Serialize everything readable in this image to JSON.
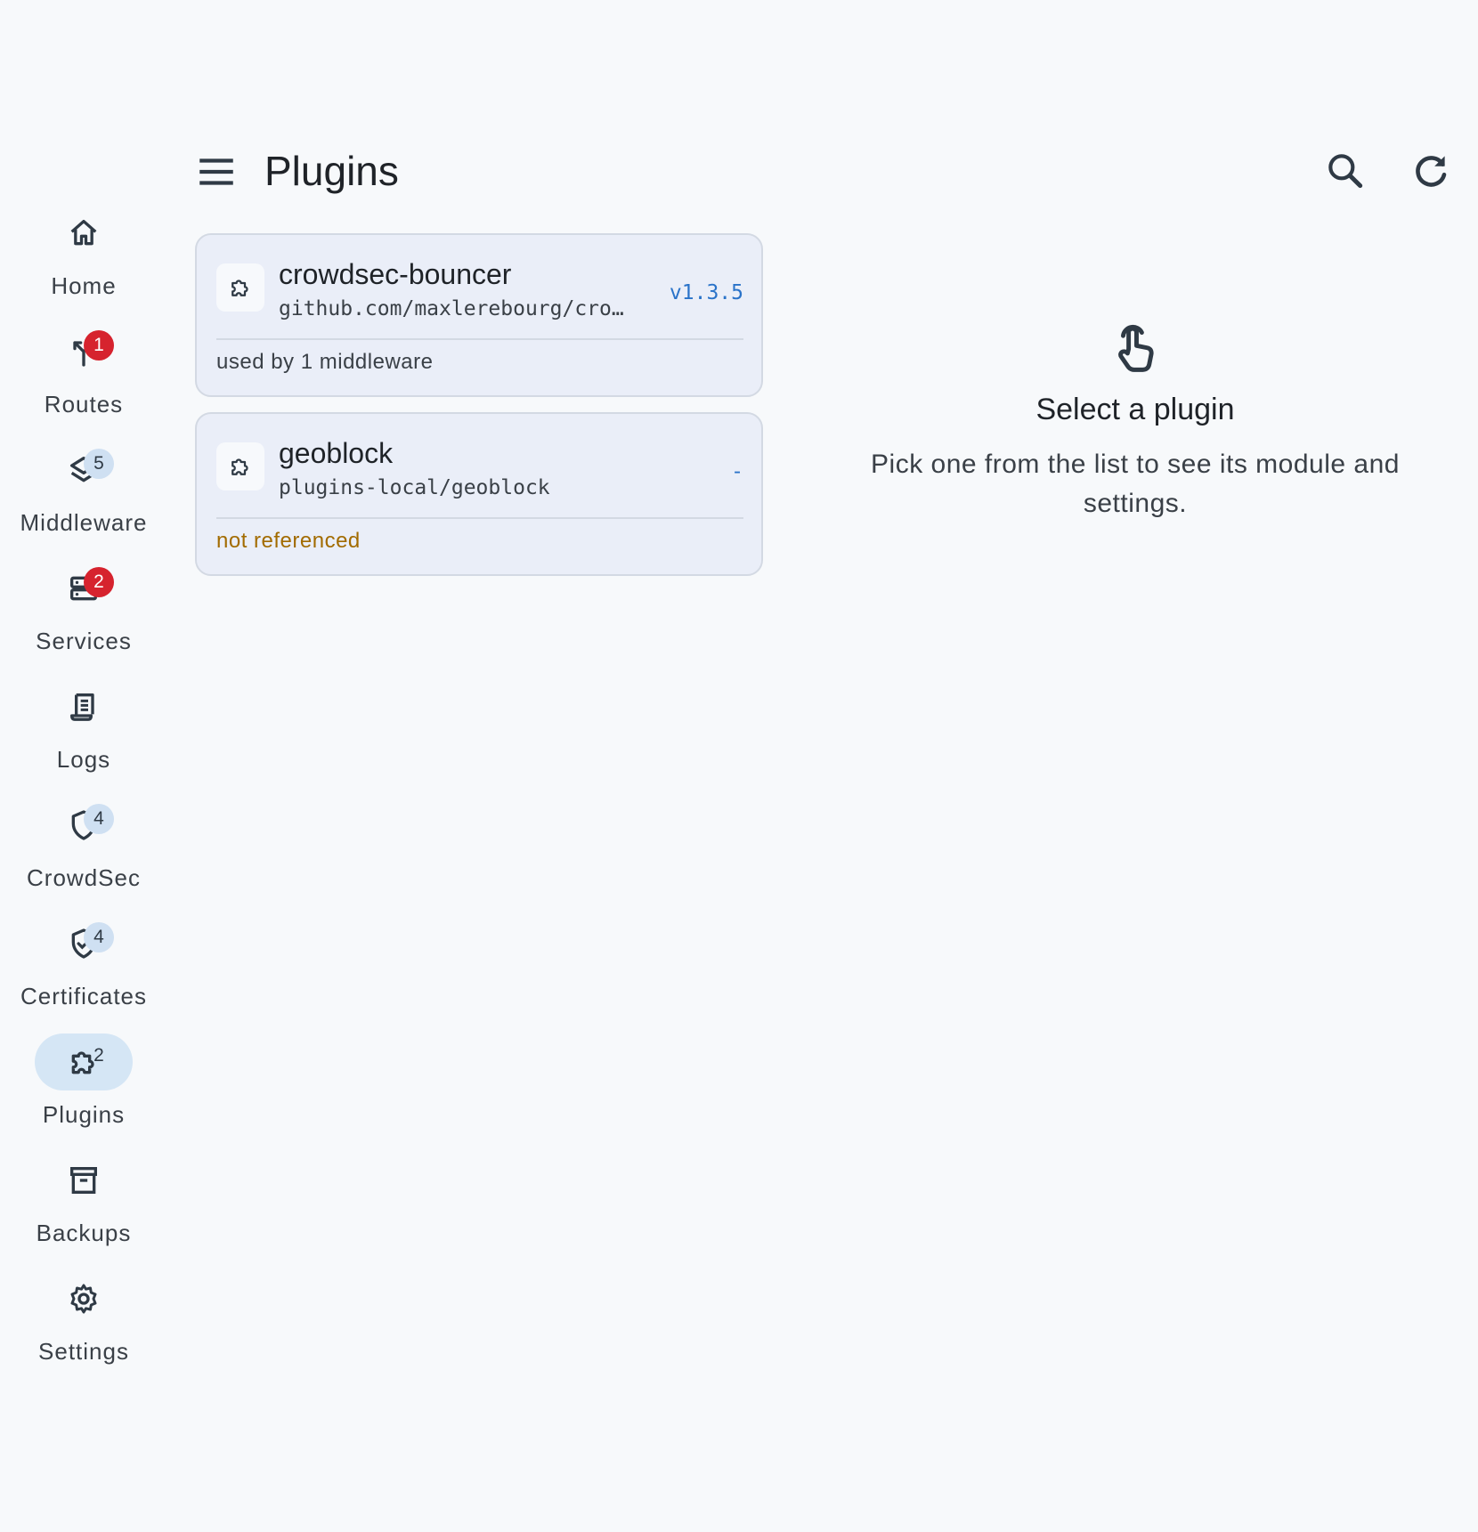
{
  "header": {
    "title": "Plugins",
    "menu_icon": "menu-icon",
    "search_icon": "search-icon",
    "refresh_icon": "refresh-icon"
  },
  "nav": {
    "items": [
      {
        "label": "Home",
        "icon": "home-icon",
        "badge": ""
      },
      {
        "label": "Routes",
        "icon": "routes-icon",
        "badge": "1",
        "badge_type": "error"
      },
      {
        "label": "Middleware",
        "icon": "layers-icon",
        "badge": "5",
        "badge_type": "info"
      },
      {
        "label": "Services",
        "icon": "server-icon",
        "badge": "2",
        "badge_type": "error"
      },
      {
        "label": "Logs",
        "icon": "logs-icon",
        "badge": ""
      },
      {
        "label": "CrowdSec",
        "icon": "shield-icon",
        "badge": "4",
        "badge_type": "info"
      },
      {
        "label": "Certificates",
        "icon": "shield-check-icon",
        "badge": "4",
        "badge_type": "info"
      },
      {
        "label": "Plugins",
        "icon": "puzzle-icon",
        "badge": "2",
        "badge_type": "plain",
        "active": true
      },
      {
        "label": "Backups",
        "icon": "archive-icon",
        "badge": ""
      },
      {
        "label": "Settings",
        "icon": "gear-icon",
        "badge": ""
      }
    ]
  },
  "plugins": [
    {
      "name": "crowdsec-bouncer",
      "module": "github.com/maxlerebourg/cro…",
      "version": "v1.3.5",
      "usage": "used by 1 middleware",
      "usage_color": "#3a4047",
      "icon": "puzzle-icon"
    },
    {
      "name": "geoblock",
      "module": "plugins-local/geoblock",
      "version": "-",
      "usage": "not referenced",
      "usage_color": "#a26b00",
      "icon": "puzzle-icon"
    }
  ],
  "empty_state": {
    "icon": "pointer-icon",
    "title": "Select a plugin",
    "text": "Pick one from the list to see its module and settings."
  },
  "colors": {
    "accent": "#2a73c9",
    "active_pill": "#d5e6f5",
    "badge_error": "#d6232e",
    "badge_info": "#cfe0f2",
    "card_bg": "#eaeef8",
    "warning_text": "#a26b00"
  }
}
